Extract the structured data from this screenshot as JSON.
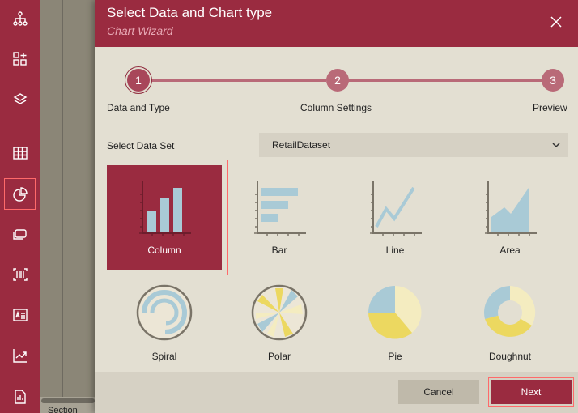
{
  "sidebar": {
    "items": [
      {
        "name": "hierarchy-icon"
      },
      {
        "name": "add-widget-icon"
      },
      {
        "name": "layers-icon"
      },
      {
        "name": "table-icon"
      },
      {
        "name": "pie-chart-icon",
        "selected": true
      },
      {
        "name": "textbox-icon"
      },
      {
        "name": "barcode-icon"
      },
      {
        "name": "rich-text-icon"
      },
      {
        "name": "trend-chart-icon"
      },
      {
        "name": "subreport-icon"
      }
    ]
  },
  "background": {
    "partial_text": "Section"
  },
  "dialog": {
    "title": "Select Data and Chart type",
    "subtitle": "Chart Wizard",
    "close_icon": "close-icon",
    "steps": [
      {
        "number": "1",
        "label": "Data and Type",
        "active": true
      },
      {
        "number": "2",
        "label": "Column Settings",
        "active": false
      },
      {
        "number": "3",
        "label": "Preview",
        "active": false
      }
    ],
    "dataset": {
      "label": "Select Data Set",
      "value": "RetailDataset"
    },
    "chart_types": [
      {
        "label": "Column",
        "icon": "column-chart-icon",
        "selected": true
      },
      {
        "label": "Bar",
        "icon": "bar-chart-icon",
        "selected": false
      },
      {
        "label": "Line",
        "icon": "line-chart-icon",
        "selected": false
      },
      {
        "label": "Area",
        "icon": "area-chart-icon",
        "selected": false
      },
      {
        "label": "Spiral",
        "icon": "spiral-chart-icon",
        "selected": false
      },
      {
        "label": "Polar",
        "icon": "polar-chart-icon",
        "selected": false
      },
      {
        "label": "Pie",
        "icon": "pie-chart-icon",
        "selected": false
      },
      {
        "label": "Doughnut",
        "icon": "doughnut-chart-icon",
        "selected": false
      }
    ],
    "buttons": {
      "cancel": "Cancel",
      "next": "Next"
    }
  },
  "colors": {
    "brand": "#9a2b40",
    "dialog_bg": "#e3dfd2",
    "chart_blue": "#a9cad6",
    "chart_yellow": "#ecd860",
    "chart_cream": "#f4ecc0",
    "axis": "#7a7468"
  }
}
